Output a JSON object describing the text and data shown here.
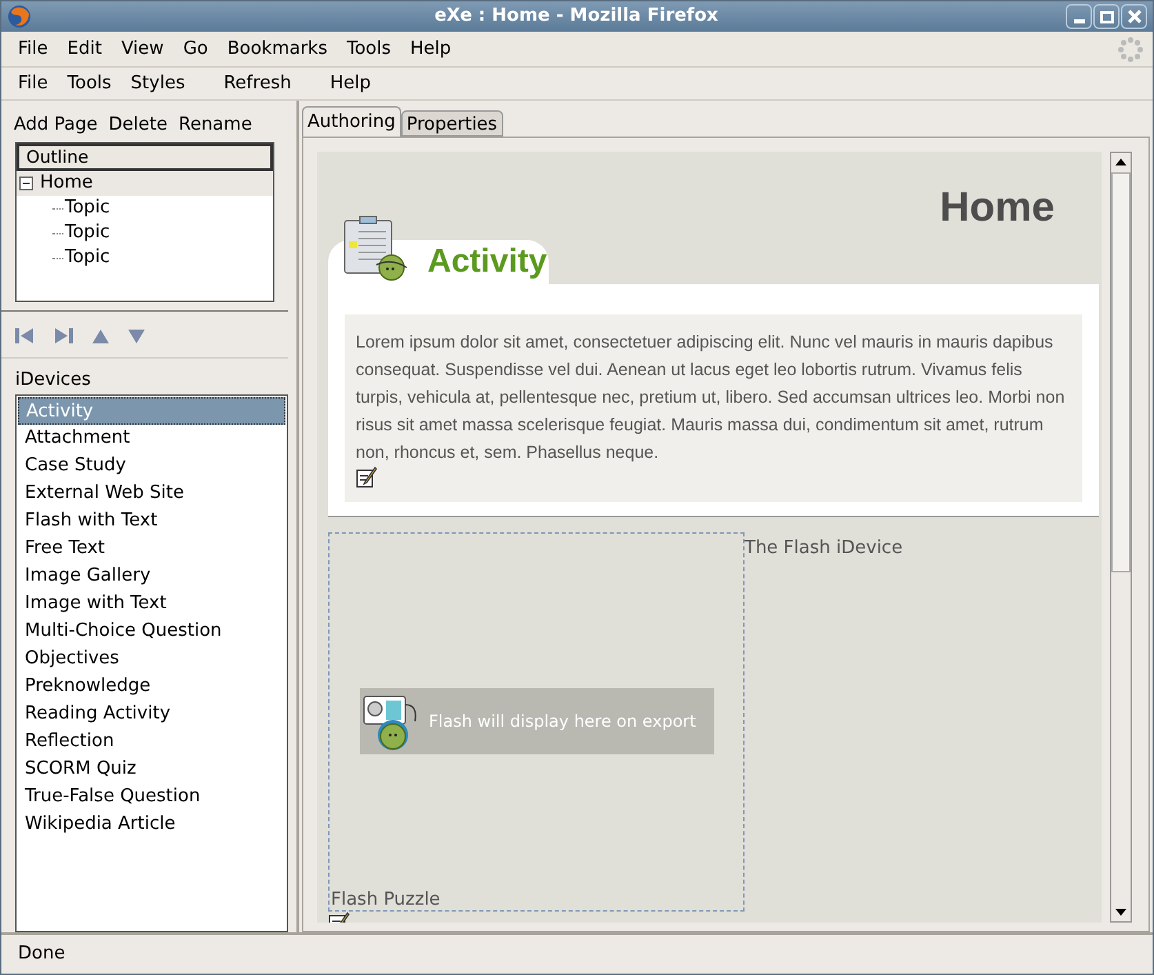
{
  "window": {
    "title": "eXe : Home - Mozilla Firefox"
  },
  "browser_menu": [
    "File",
    "Edit",
    "View",
    "Go",
    "Bookmarks",
    "Tools",
    "Help"
  ],
  "app_menu": [
    "File",
    "Tools",
    "Styles",
    "Refresh",
    "Help"
  ],
  "outline_toolbar": [
    "Add Page",
    "Delete",
    "Rename"
  ],
  "outline": {
    "header": "Outline",
    "tree": [
      {
        "label": "Home",
        "expanded": true,
        "selected": true,
        "children": [
          {
            "label": "Topic",
            "selected": false
          },
          {
            "label": "Topic",
            "selected": false
          },
          {
            "label": "Topic",
            "selected": false
          }
        ]
      }
    ]
  },
  "idevices": {
    "title": "iDevices",
    "items": [
      {
        "label": "Activity",
        "selected": true
      },
      {
        "label": "Attachment",
        "selected": false
      },
      {
        "label": "Case Study",
        "selected": false
      },
      {
        "label": "External Web Site",
        "selected": false
      },
      {
        "label": "Flash with Text",
        "selected": false
      },
      {
        "label": "Free Text",
        "selected": false
      },
      {
        "label": "Image Gallery",
        "selected": false
      },
      {
        "label": "Image with Text",
        "selected": false
      },
      {
        "label": "Multi-Choice Question",
        "selected": false
      },
      {
        "label": "Objectives",
        "selected": false
      },
      {
        "label": "Preknowledge",
        "selected": false
      },
      {
        "label": "Reading Activity",
        "selected": false
      },
      {
        "label": "Reflection",
        "selected": false
      },
      {
        "label": "SCORM Quiz",
        "selected": false
      },
      {
        "label": "True-False Question",
        "selected": false
      },
      {
        "label": "Wikipedia Article",
        "selected": false
      }
    ]
  },
  "tabs": [
    {
      "label": "Authoring",
      "selected": true
    },
    {
      "label": "Properties",
      "selected": false
    }
  ],
  "page": {
    "title": "Home",
    "activity": {
      "title": "Activity",
      "text": "Lorem ipsum dolor sit amet, consectetuer adipiscing elit. Nunc vel mauris in mauris dapibus consequat. Suspendisse vel dui. Aenean ut lacus eget leo lobortis rutrum. Vivamus felis turpis, vehicula at, pellentesque nec, pretium ut, libero. Sed accumsan ultrices leo. Morbi non risus sit amet massa scelerisque feugiat. Mauris massa dui, condimentum sit amet, rutrum non, rhoncus et, sem. Phasellus neque."
    },
    "flash": {
      "caption": "The Flash iDevice",
      "notice": "Flash will display here on export",
      "name": "Flash Puzzle"
    }
  },
  "status_bar": "Done"
}
